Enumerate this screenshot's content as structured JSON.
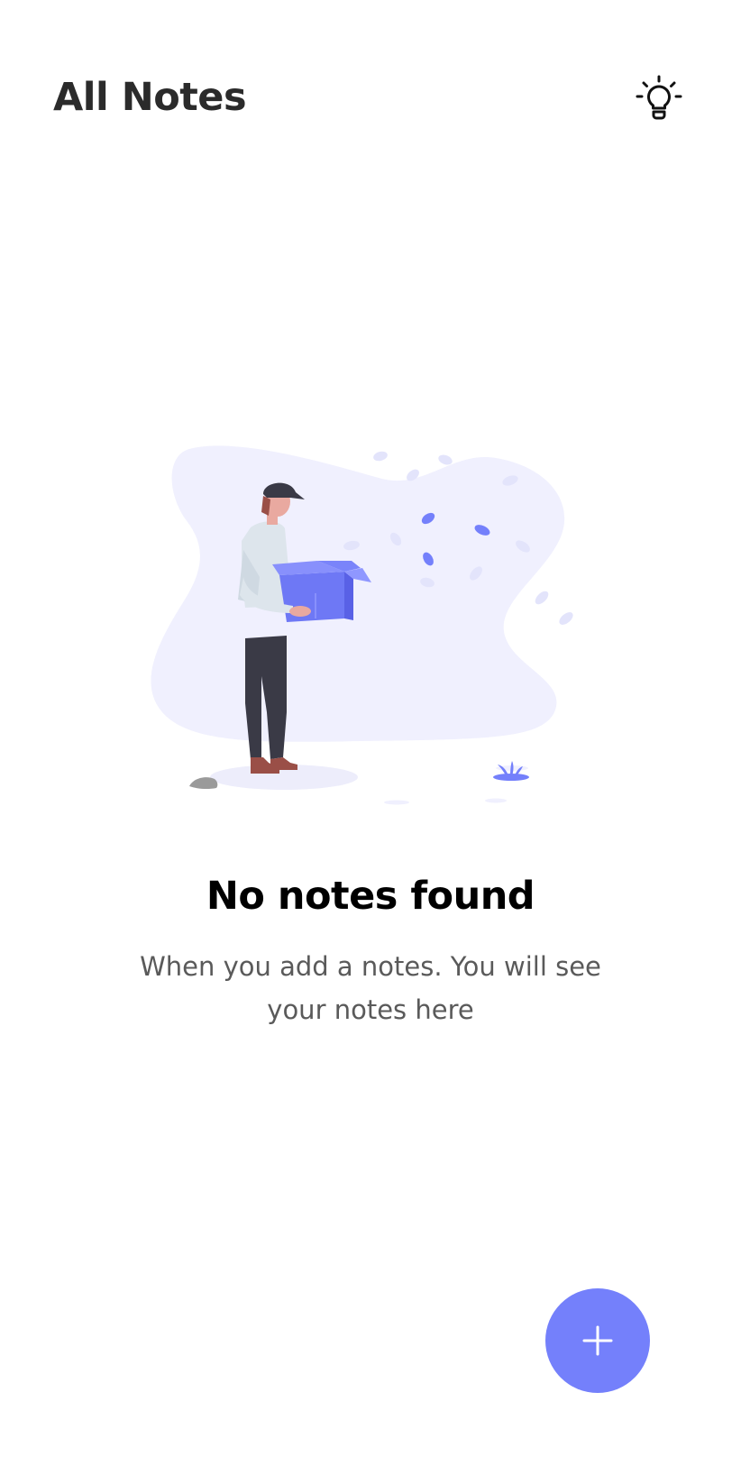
{
  "header": {
    "title": "All Notes",
    "theme_toggle_icon": "lightbulb-icon"
  },
  "empty_state": {
    "illustration": "person-holding-open-box-illustration",
    "title": "No notes found",
    "subtitle": "When you add a notes. You will see your notes here"
  },
  "fab": {
    "icon": "plus-icon",
    "color": "#7480fb"
  },
  "colors": {
    "accent": "#7480fb",
    "illustration_background": "#f0f0fe",
    "title_text": "#2b2b2b",
    "subtitle_text": "#5a5a5a"
  }
}
